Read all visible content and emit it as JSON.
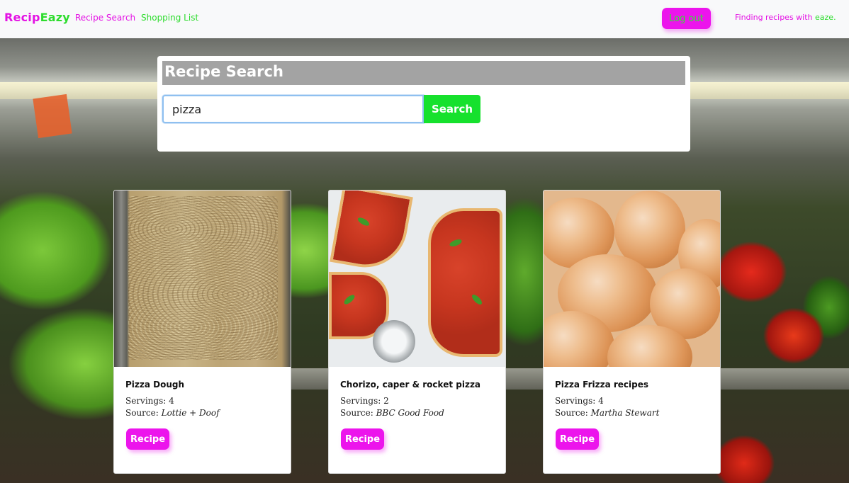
{
  "navbar": {
    "brand_part1": "Recip",
    "brand_part2": "Eazy",
    "links": [
      {
        "label": "Recipe Search"
      },
      {
        "label": "Shopping List"
      }
    ],
    "logout_label": "Log out",
    "tagline_main": "Finding recipes with ",
    "tagline_accent": "eaze."
  },
  "search": {
    "title": "Recipe Search",
    "query_value": "pizza",
    "button_label": "Search"
  },
  "cards": [
    {
      "title": "Pizza Dough",
      "servings": "Servings: 4",
      "source_prefix": "Source: ",
      "source_name": "Lottie + Doof",
      "button_label": "Recipe"
    },
    {
      "title": "Chorizo, caper & rocket pizza",
      "servings": "Servings: 2",
      "source_prefix": "Source: ",
      "source_name": "BBC Good Food",
      "button_label": "Recipe"
    },
    {
      "title": "Pizza Frizza recipes",
      "servings": "Servings: 4",
      "source_prefix": "Source: ",
      "source_name": "Martha Stewart",
      "button_label": "Recipe"
    }
  ],
  "colors": {
    "magenta": "#ec14ec",
    "green": "#16e12d",
    "title_bar": "#a3a3a3"
  }
}
